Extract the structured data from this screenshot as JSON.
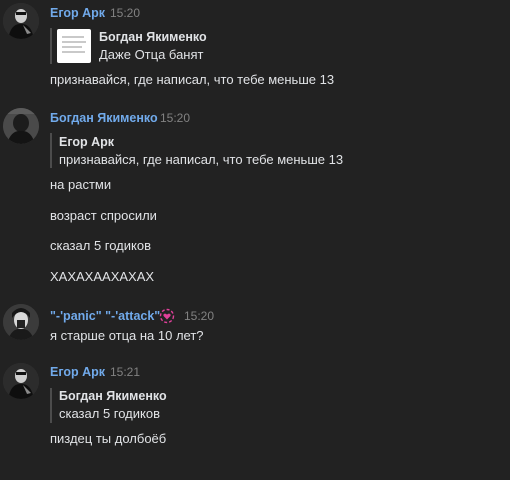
{
  "colors": {
    "background": "#222222",
    "author_name": "#71aaeb",
    "text": "#e1e3e6",
    "timestamp": "#828282",
    "quote_bar": "#4c4c4c",
    "heart_accent": "#e0409a"
  },
  "messages": [
    {
      "author": "Егор Арк",
      "time": "15:20",
      "avatar_icon": "avatar-dark-photo",
      "reply": {
        "author": "Богдан Якименко",
        "text": "Даже Отца банят",
        "thumbnail_icon": "document-thumbnail-icon"
      },
      "lines": [
        "признавайся, где написал, что тебе меньше 13"
      ]
    },
    {
      "author": "Богдан Якименко",
      "time": "15:20",
      "avatar_icon": "avatar-dark-photo",
      "reply": {
        "author": "Егор Арк",
        "text": "признавайся, где написал, что тебе меньше 13"
      },
      "lines": [
        "на растми",
        "возраст спросили",
        "сказал 5 годиков",
        "ХАХАХААХАХАХ"
      ]
    },
    {
      "author": "\"-'panic\" \"-'attack\"",
      "time": "15:20",
      "avatar_icon": "avatar-dark-photo",
      "badge_icon": "heart-icon",
      "lines": [
        "я старше отца на 10 лет?"
      ]
    },
    {
      "author": "Егор Арк",
      "time": "15:21",
      "avatar_icon": "avatar-dark-photo",
      "reply": {
        "author": "Богдан Якименко",
        "text": "сказал 5 годиков"
      },
      "lines": [
        "пиздец ты долбоёб"
      ]
    }
  ]
}
